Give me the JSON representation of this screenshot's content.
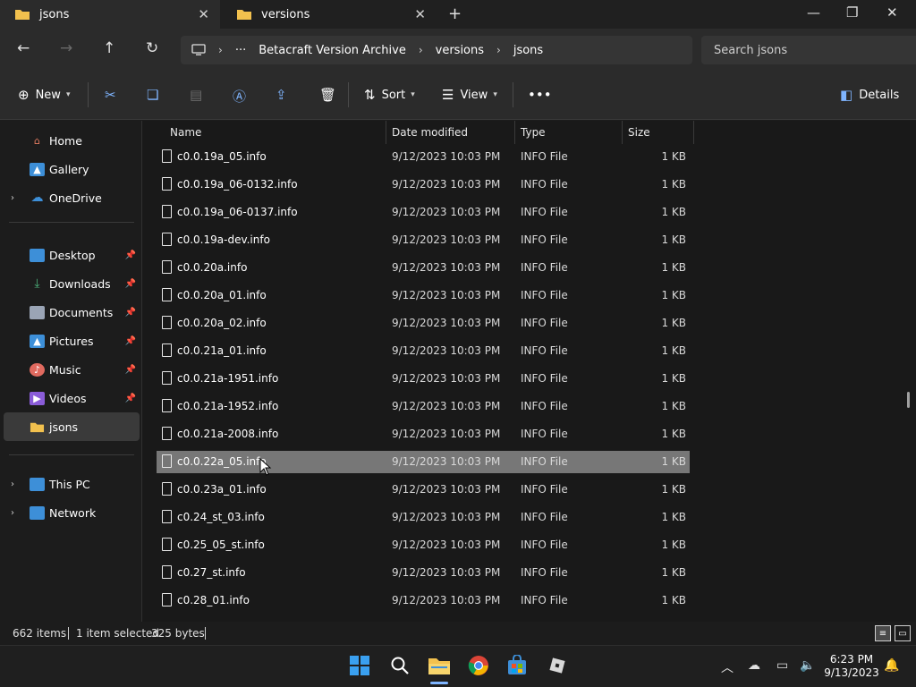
{
  "tabs": [
    {
      "label": "jsons",
      "active": true
    },
    {
      "label": "versions",
      "active": false
    }
  ],
  "address": {
    "crumbs": [
      "Betacraft Version Archive",
      "versions",
      "jsons"
    ]
  },
  "search": {
    "placeholder": "Search jsons"
  },
  "commands": {
    "new": "New",
    "sort": "Sort",
    "view": "View",
    "details": "Details"
  },
  "sidebar": {
    "items": [
      {
        "label": "Home"
      },
      {
        "label": "Gallery"
      },
      {
        "label": "OneDrive"
      },
      {
        "label": "Desktop"
      },
      {
        "label": "Downloads"
      },
      {
        "label": "Documents"
      },
      {
        "label": "Pictures"
      },
      {
        "label": "Music"
      },
      {
        "label": "Videos"
      },
      {
        "label": "jsons"
      },
      {
        "label": "This PC"
      },
      {
        "label": "Network"
      }
    ]
  },
  "columns": {
    "name": "Name",
    "date": "Date modified",
    "type": "Type",
    "size": "Size"
  },
  "files": [
    {
      "name": "c0.0.19a_05.info",
      "date": "9/12/2023 10:03 PM",
      "type": "INFO File",
      "size": "1 KB"
    },
    {
      "name": "c0.0.19a_06-0132.info",
      "date": "9/12/2023 10:03 PM",
      "type": "INFO File",
      "size": "1 KB"
    },
    {
      "name": "c0.0.19a_06-0137.info",
      "date": "9/12/2023 10:03 PM",
      "type": "INFO File",
      "size": "1 KB"
    },
    {
      "name": "c0.0.19a-dev.info",
      "date": "9/12/2023 10:03 PM",
      "type": "INFO File",
      "size": "1 KB"
    },
    {
      "name": "c0.0.20a.info",
      "date": "9/12/2023 10:03 PM",
      "type": "INFO File",
      "size": "1 KB"
    },
    {
      "name": "c0.0.20a_01.info",
      "date": "9/12/2023 10:03 PM",
      "type": "INFO File",
      "size": "1 KB"
    },
    {
      "name": "c0.0.20a_02.info",
      "date": "9/12/2023 10:03 PM",
      "type": "INFO File",
      "size": "1 KB"
    },
    {
      "name": "c0.0.21a_01.info",
      "date": "9/12/2023 10:03 PM",
      "type": "INFO File",
      "size": "1 KB"
    },
    {
      "name": "c0.0.21a-1951.info",
      "date": "9/12/2023 10:03 PM",
      "type": "INFO File",
      "size": "1 KB"
    },
    {
      "name": "c0.0.21a-1952.info",
      "date": "9/12/2023 10:03 PM",
      "type": "INFO File",
      "size": "1 KB"
    },
    {
      "name": "c0.0.21a-2008.info",
      "date": "9/12/2023 10:03 PM",
      "type": "INFO File",
      "size": "1 KB"
    },
    {
      "name": "c0.0.22a_05.info",
      "date": "9/12/2023 10:03 PM",
      "type": "INFO File",
      "size": "1 KB",
      "selected": true
    },
    {
      "name": "c0.0.23a_01.info",
      "date": "9/12/2023 10:03 PM",
      "type": "INFO File",
      "size": "1 KB"
    },
    {
      "name": "c0.24_st_03.info",
      "date": "9/12/2023 10:03 PM",
      "type": "INFO File",
      "size": "1 KB"
    },
    {
      "name": "c0.25_05_st.info",
      "date": "9/12/2023 10:03 PM",
      "type": "INFO File",
      "size": "1 KB"
    },
    {
      "name": "c0.27_st.info",
      "date": "9/12/2023 10:03 PM",
      "type": "INFO File",
      "size": "1 KB"
    },
    {
      "name": "c0.28_01.info",
      "date": "9/12/2023 10:03 PM",
      "type": "INFO File",
      "size": "1 KB"
    }
  ],
  "status": {
    "items": "662 items",
    "selected": "1 item selected",
    "size": "325 bytes"
  },
  "clock": {
    "time": "6:23 PM",
    "date": "9/13/2023"
  },
  "colors": {
    "folder": "#f2c14e",
    "selection": "#777777",
    "accent": "#7fb5ff"
  }
}
